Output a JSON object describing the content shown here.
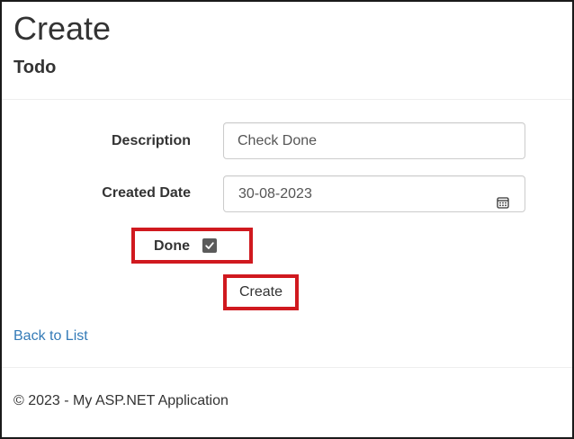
{
  "page": {
    "title": "Create",
    "subtitle": "Todo"
  },
  "form": {
    "description_label": "Description",
    "description_value": "Check Done",
    "created_date_label": "Created Date",
    "created_date_value": "30-08-2023",
    "done_label": "Done",
    "done_checked": true,
    "create_button_label": "Create"
  },
  "links": {
    "back_to_list": "Back to List"
  },
  "footer": {
    "text": "© 2023 - My ASP.NET Application"
  },
  "icons": {
    "date_picker": "calendar-icon",
    "checkbox_mark": "check-icon"
  },
  "colors": {
    "highlight": "#d0191f",
    "link": "#337ab7",
    "text": "#333333"
  }
}
